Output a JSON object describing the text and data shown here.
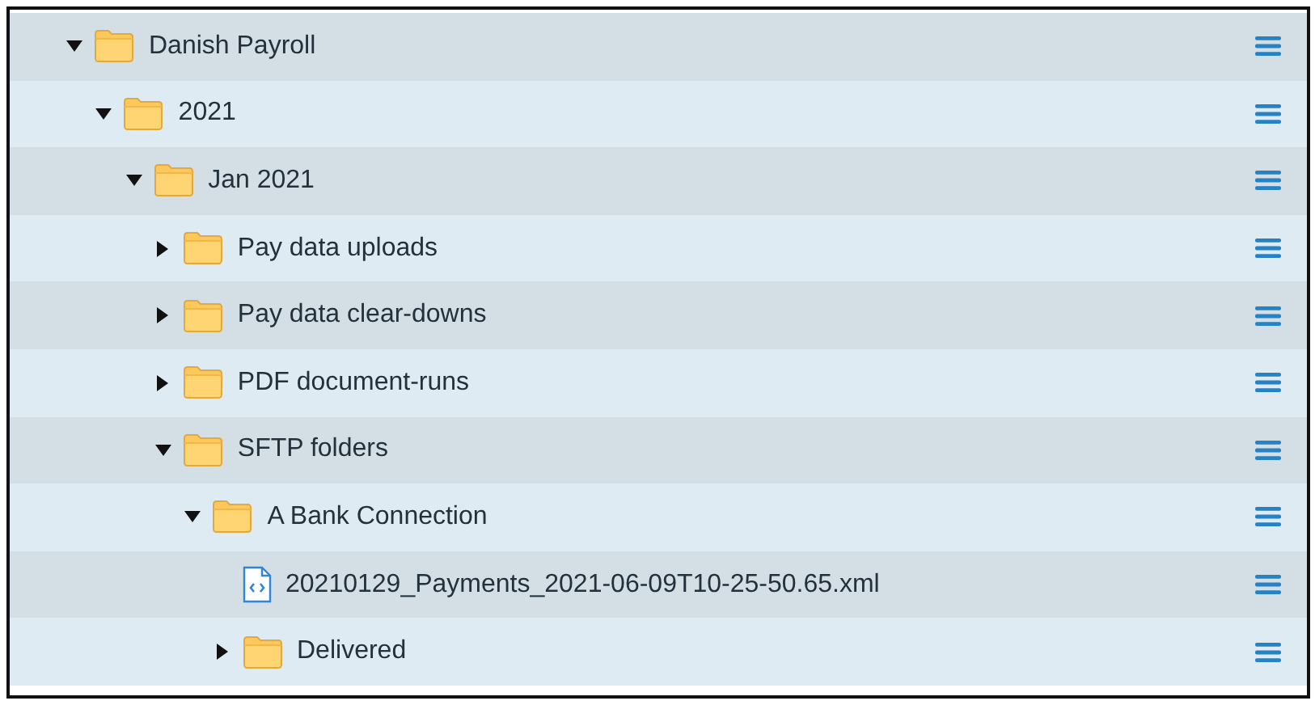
{
  "tree": [
    {
      "kind": "folder",
      "label": "Danish Payroll",
      "expanded": true,
      "children": [
        {
          "kind": "folder",
          "label": "2021",
          "expanded": true,
          "children": [
            {
              "kind": "folder",
              "label": "Jan 2021",
              "expanded": true,
              "children": [
                {
                  "kind": "folder",
                  "label": "Pay data uploads",
                  "expanded": false
                },
                {
                  "kind": "folder",
                  "label": "Pay data clear-downs",
                  "expanded": false
                },
                {
                  "kind": "folder",
                  "label": "PDF document-runs",
                  "expanded": false
                },
                {
                  "kind": "folder",
                  "label": "SFTP folders",
                  "expanded": true,
                  "children": [
                    {
                      "kind": "folder",
                      "label": "A Bank Connection",
                      "expanded": true,
                      "children": [
                        {
                          "kind": "file",
                          "label": "20210129_Payments_2021-06-09T10-25-50.65.xml"
                        },
                        {
                          "kind": "folder",
                          "label": "Delivered",
                          "expanded": false
                        }
                      ]
                    }
                  ]
                }
              ]
            }
          ]
        }
      ]
    }
  ]
}
